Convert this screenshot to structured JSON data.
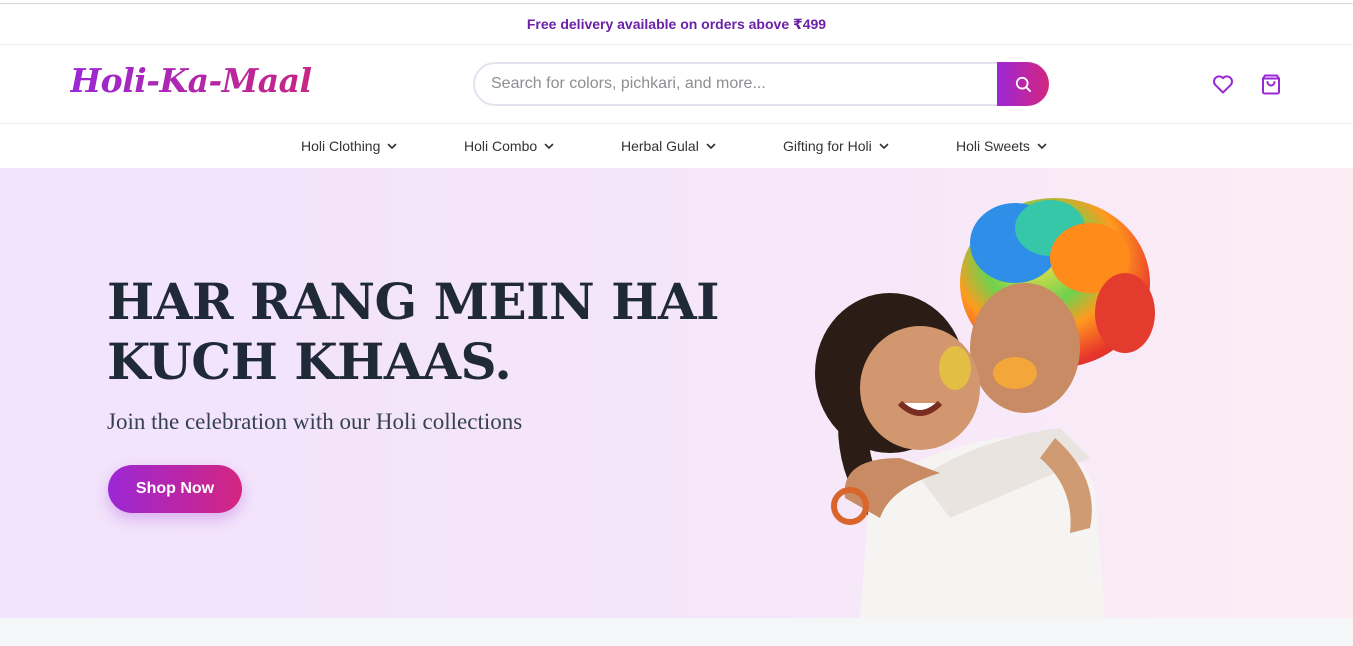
{
  "announcement": {
    "text": "Free delivery available on orders above ₹499"
  },
  "header": {
    "logo_text": "Holi-Ka-Maal",
    "search": {
      "placeholder": "Search for colors, pichkari, and more...",
      "value": ""
    },
    "icons": {
      "search": "search-icon",
      "wishlist": "heart-icon",
      "cart": "shopping-bag-icon"
    }
  },
  "nav": {
    "items": [
      {
        "label": "Holi Clothing"
      },
      {
        "label": "Holi Combo"
      },
      {
        "label": "Herbal Gulal"
      },
      {
        "label": "Gifting for Holi"
      },
      {
        "label": "Holi Sweets"
      }
    ],
    "dropdown_icon": "chevron-down-icon"
  },
  "hero": {
    "title_line1": "HAR RANG MEIN HAI",
    "title_line2": "KUCH KHAAS.",
    "subtitle": "Join the celebration with our Holi collections",
    "cta_label": "Shop Now",
    "image": "two-children-hugging-photo"
  },
  "colors": {
    "brand_purple": "#9b27d6",
    "brand_pink": "#d4267f",
    "announcement_text": "#6b21a8",
    "hero_bg": "#f3e5fa",
    "heading": "#1f2937"
  }
}
